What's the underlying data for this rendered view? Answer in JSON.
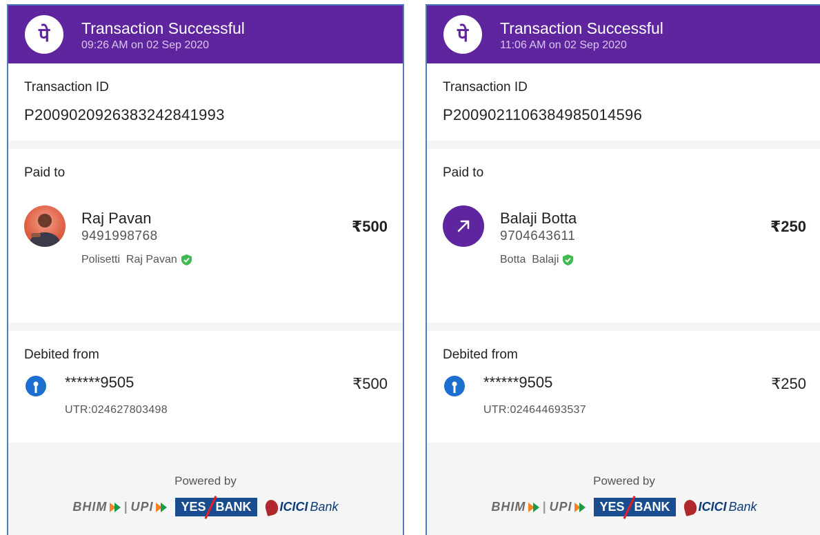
{
  "brand": {
    "primary": "#5f259f",
    "verified": "#3fb950",
    "bank_icon": "#1c6ecf"
  },
  "receipts": [
    {
      "header": {
        "title": "Transaction Successful",
        "datetime": "09:26 AM on 02 Sep 2020",
        "logo_glyph": "पे"
      },
      "transaction": {
        "label": "Transaction ID",
        "id": "P2009020926383242841993"
      },
      "paid_to": {
        "label": "Paid to",
        "name": "Raj Pavan",
        "phone": "9491998768",
        "verified_name": "Polisetti  Raj Pavan",
        "amount": "₹500",
        "avatar": "profile-photo"
      },
      "debited_from": {
        "label": "Debited from",
        "account": "******9505",
        "amount": "₹500",
        "utr": "UTR:024627803498"
      },
      "footer": {
        "powered_by": "Powered by",
        "partners": [
          "BHIM",
          "UPI",
          "YES",
          "BANK",
          "ICICI",
          "Bank"
        ]
      }
    },
    {
      "header": {
        "title": "Transaction Successful",
        "datetime": "11:06 AM on 02 Sep 2020",
        "logo_glyph": "पे"
      },
      "transaction": {
        "label": "Transaction ID",
        "id": "P2009021106384985014596"
      },
      "paid_to": {
        "label": "Paid to",
        "name": "Balaji Botta",
        "phone": "9704643611",
        "verified_name": "Botta  Balaji",
        "amount": "₹250",
        "avatar": "arrow-up-right-icon"
      },
      "debited_from": {
        "label": "Debited from",
        "account": "******9505",
        "amount": "₹250",
        "utr": "UTR:024644693537"
      },
      "footer": {
        "powered_by": "Powered by",
        "partners": [
          "BHIM",
          "UPI",
          "YES",
          "BANK",
          "ICICI",
          "Bank"
        ]
      }
    }
  ]
}
